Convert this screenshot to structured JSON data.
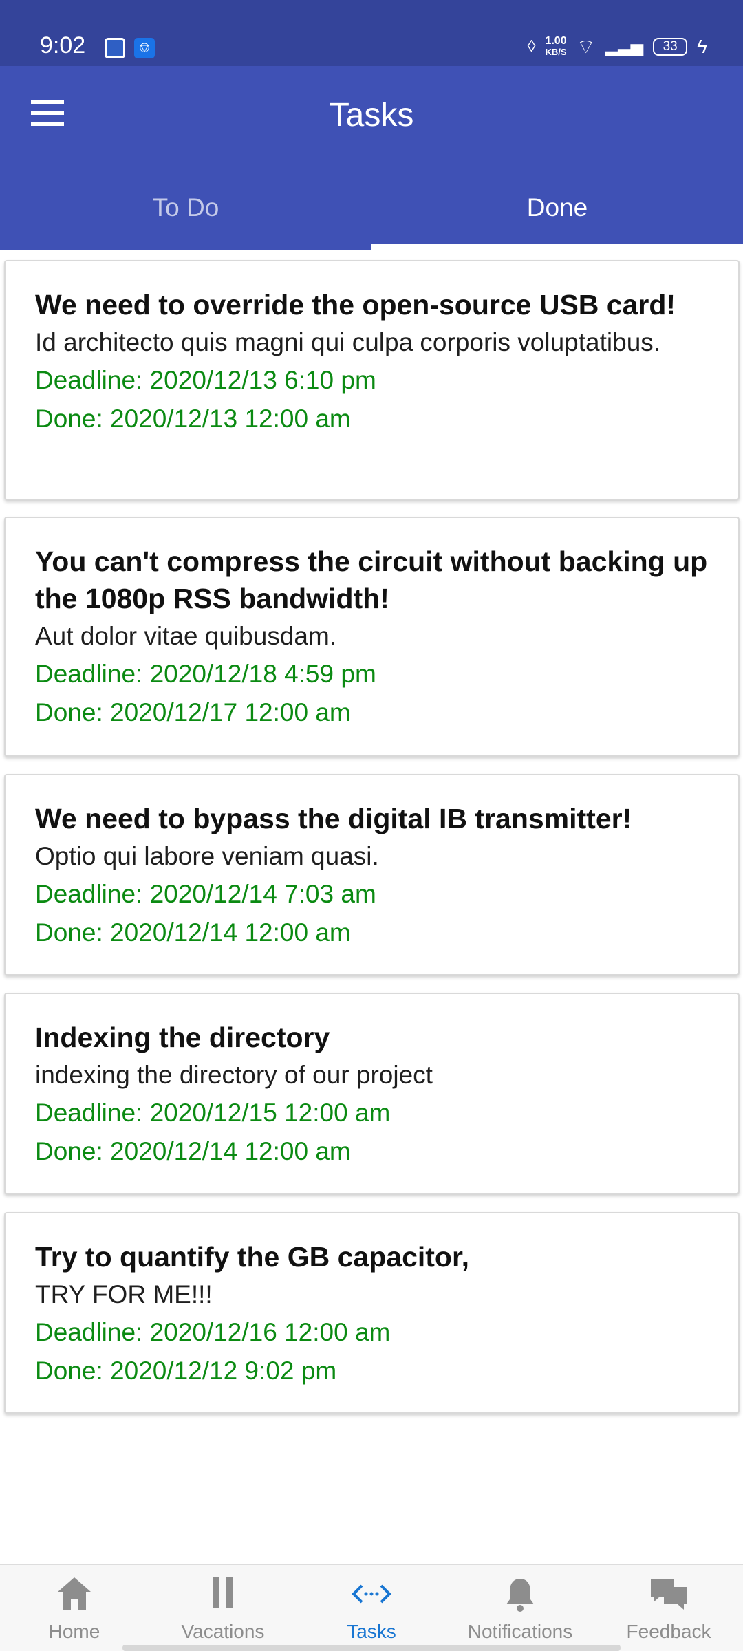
{
  "status_bar": {
    "time": "9:02",
    "net_speed_value": "1.00",
    "net_speed_unit": "KB/S",
    "battery_level": "33"
  },
  "app_bar": {
    "title": "Tasks"
  },
  "tabs": [
    {
      "label": "To Do",
      "selected": false
    },
    {
      "label": "Done",
      "selected": true
    }
  ],
  "tasks": [
    {
      "title": "We need to override the open-source USB card!",
      "description": "Id architecto quis magni qui culpa corporis voluptatibus.",
      "deadline": "Deadline: 2020/12/13 6:10 pm",
      "done": "Done: 2020/12/13 12:00 am"
    },
    {
      "title": "You can't compress the circuit without backing up the 1080p RSS bandwidth!",
      "description": "Aut dolor vitae quibusdam.",
      "deadline": "Deadline: 2020/12/18 4:59 pm",
      "done": "Done: 2020/12/17 12:00 am"
    },
    {
      "title": "We need to bypass the digital IB transmitter!",
      "description": "Optio qui labore veniam quasi.",
      "deadline": "Deadline: 2020/12/14 7:03 am",
      "done": "Done: 2020/12/14 12:00 am"
    },
    {
      "title": "Indexing the directory",
      "description": "indexing the directory of our project",
      "deadline": "Deadline: 2020/12/15 12:00 am",
      "done": "Done: 2020/12/14 12:00 am"
    },
    {
      "title": "Try to quantify the GB capacitor,",
      "description": "TRY FOR ME!!!",
      "deadline": "Deadline: 2020/12/16 12:00 am",
      "done": "Done: 2020/12/12 9:02 pm"
    }
  ],
  "bottom_nav": [
    {
      "label": "Home",
      "icon": "home-icon",
      "active": false
    },
    {
      "label": "Vacations",
      "icon": "pause-icon",
      "active": false
    },
    {
      "label": "Tasks",
      "icon": "code-icon",
      "active": true
    },
    {
      "label": "Notifications",
      "icon": "bell-icon",
      "active": false
    },
    {
      "label": "Feedback",
      "icon": "chat-icon",
      "active": false
    }
  ],
  "colors": {
    "primary": "#3f51b5",
    "status_bar": "#34449a",
    "accent_active": "#1976d2",
    "date_text": "#0b8a12",
    "inactive_nav": "#8d8d8d"
  }
}
